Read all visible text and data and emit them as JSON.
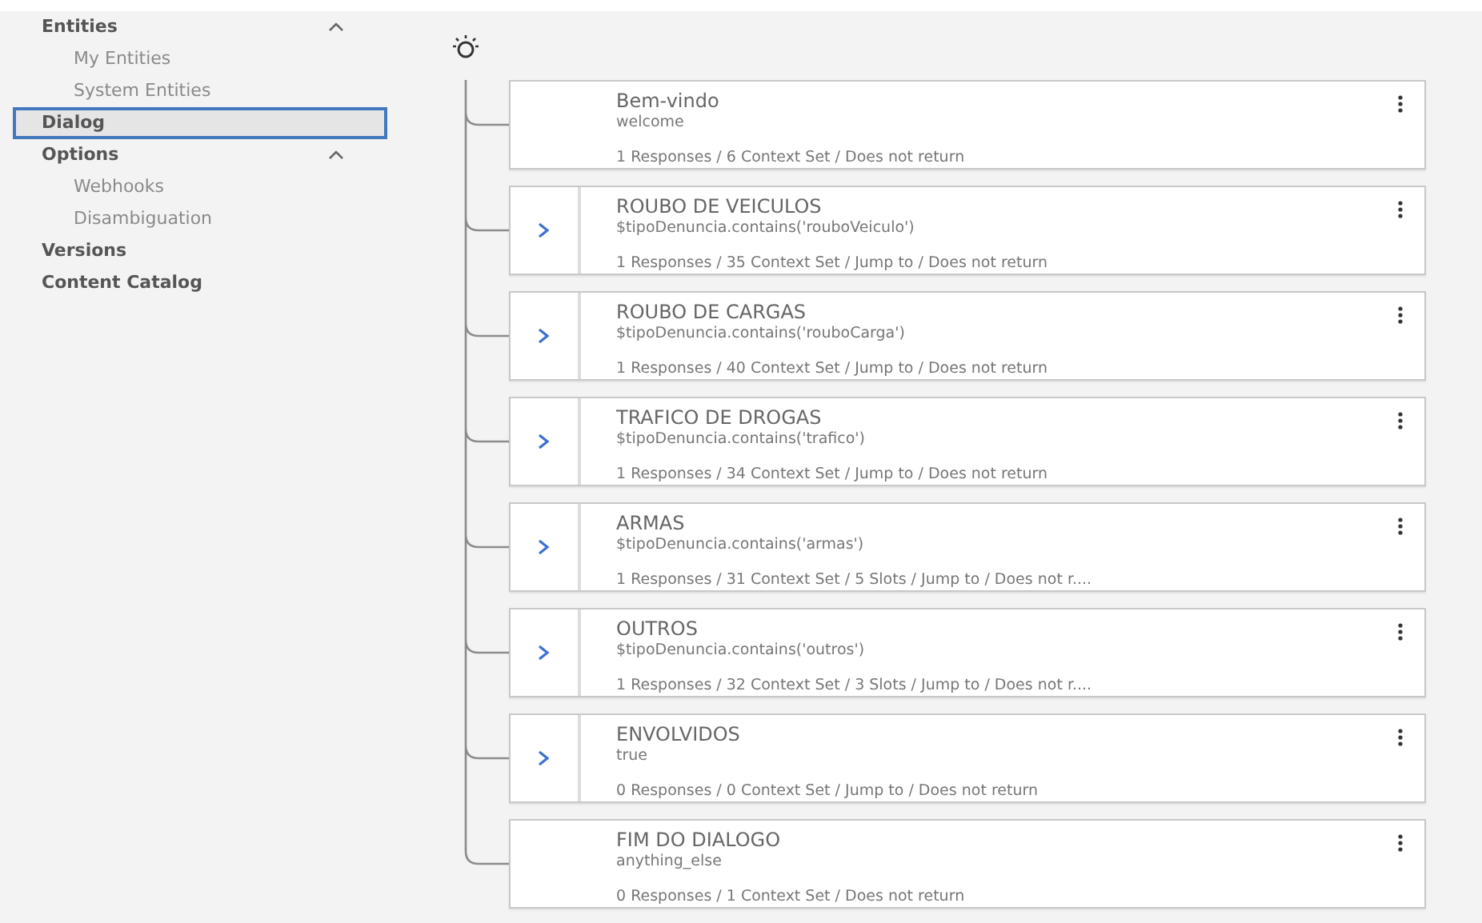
{
  "sidebar": {
    "items": [
      {
        "label": "Entities",
        "kind": "header",
        "expanded": true,
        "selected": false
      },
      {
        "label": "My Entities",
        "kind": "sub",
        "selected": false
      },
      {
        "label": "System Entities",
        "kind": "sub",
        "selected": false
      },
      {
        "label": "Dialog",
        "kind": "header",
        "selected": true
      },
      {
        "label": "Options",
        "kind": "header",
        "expanded": true,
        "selected": false
      },
      {
        "label": "Webhooks",
        "kind": "sub",
        "selected": false
      },
      {
        "label": "Disambiguation",
        "kind": "sub",
        "selected": false
      },
      {
        "label": "Versions",
        "kind": "header",
        "selected": false
      },
      {
        "label": "Content Catalog",
        "kind": "header",
        "selected": false
      }
    ]
  },
  "dialog_tree": {
    "nodes": [
      {
        "title": "Bem-vindo",
        "condition": "welcome",
        "summary": "1 Responses / 6 Context Set / Does not return",
        "has_children": false
      },
      {
        "title": "ROUBO DE VEICULOS",
        "condition": "$tipoDenuncia.contains('rouboVeiculo')",
        "summary": "1 Responses / 35 Context Set / Jump to / Does not return",
        "has_children": true
      },
      {
        "title": "ROUBO DE CARGAS",
        "condition": "$tipoDenuncia.contains('rouboCarga')",
        "summary": "1 Responses / 40 Context Set / Jump to / Does not return",
        "has_children": true
      },
      {
        "title": "TRAFICO DE DROGAS",
        "condition": "$tipoDenuncia.contains('trafico')",
        "summary": "1 Responses / 34 Context Set / Jump to / Does not return",
        "has_children": true
      },
      {
        "title": "ARMAS",
        "condition": "$tipoDenuncia.contains('armas')",
        "summary": "1 Responses / 31 Context Set / 5 Slots / Jump to / Does not r....",
        "has_children": true
      },
      {
        "title": "OUTROS",
        "condition": "$tipoDenuncia.contains('outros')",
        "summary": "1 Responses / 32 Context Set / 3 Slots / Jump to / Does not r....",
        "has_children": true
      },
      {
        "title": "ENVOLVIDOS",
        "condition": "true",
        "summary": "0 Responses / 0 Context Set / Jump to / Does not return",
        "has_children": true
      },
      {
        "title": "FIM DO DIALOGO",
        "condition": "anything_else",
        "summary": "0 Responses / 1 Context Set / Does not return",
        "has_children": false
      }
    ]
  }
}
